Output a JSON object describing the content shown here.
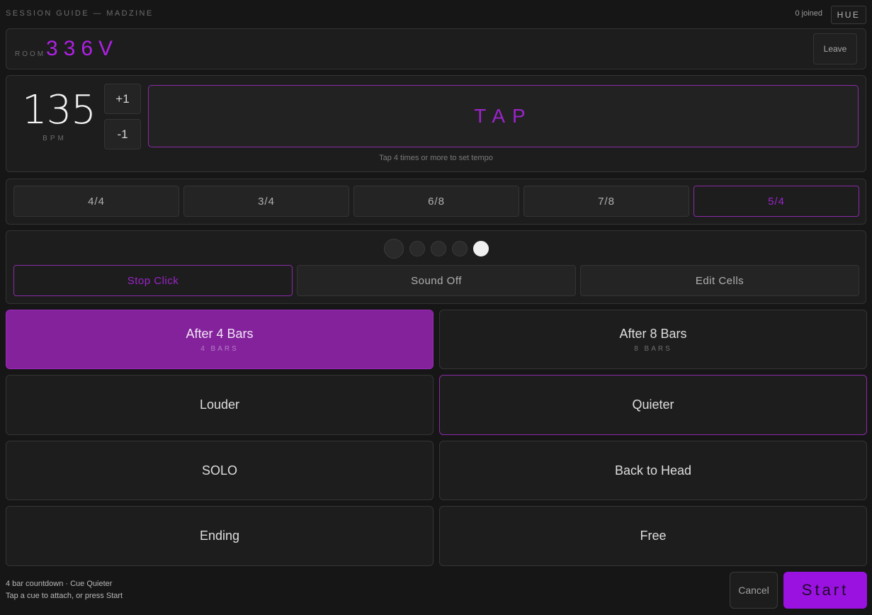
{
  "header": {
    "app_title": "SESSION GUIDE — MADZINE",
    "joined": "0 joined",
    "hue_label": "HUE"
  },
  "room": {
    "label": "ROOM",
    "code": "336V",
    "leave_label": "Leave"
  },
  "tempo": {
    "bpm": "135",
    "unit": "BPM",
    "increment_label": "+1",
    "decrement_label": "-1",
    "tap_label": "TAP",
    "hint": "Tap 4 times or more to set tempo"
  },
  "time_signatures": {
    "options": [
      "4/4",
      "3/4",
      "6/8",
      "7/8",
      "5/4"
    ],
    "selected": "5/4"
  },
  "click": {
    "beat_count": 5,
    "active_beat": 5,
    "stop_label": "Stop Click",
    "sound_label": "Sound Off",
    "edit_label": "Edit Cells"
  },
  "cues": [
    {
      "name": "After 4 Bars",
      "sub": "4 BARS",
      "state": "selected"
    },
    {
      "name": "After 8 Bars",
      "sub": "8 BARS",
      "state": "normal"
    },
    {
      "name": "Louder",
      "sub": "",
      "state": "normal"
    },
    {
      "name": "Quieter",
      "sub": "",
      "state": "outlined"
    },
    {
      "name": "SOLO",
      "sub": "",
      "state": "normal"
    },
    {
      "name": "Back to Head",
      "sub": "",
      "state": "normal"
    },
    {
      "name": "Ending",
      "sub": "",
      "state": "normal"
    },
    {
      "name": "Free",
      "sub": "",
      "state": "normal"
    }
  ],
  "footer": {
    "status_line1": "4 bar countdown · Cue Quieter",
    "status_line2": "Tap a cue to attach, or press Start",
    "cancel_label": "Cancel",
    "start_label": "Start"
  },
  "colors": {
    "accent": "#9a12e0",
    "selected_cue_bg": "#84229c",
    "background": "#161616"
  }
}
